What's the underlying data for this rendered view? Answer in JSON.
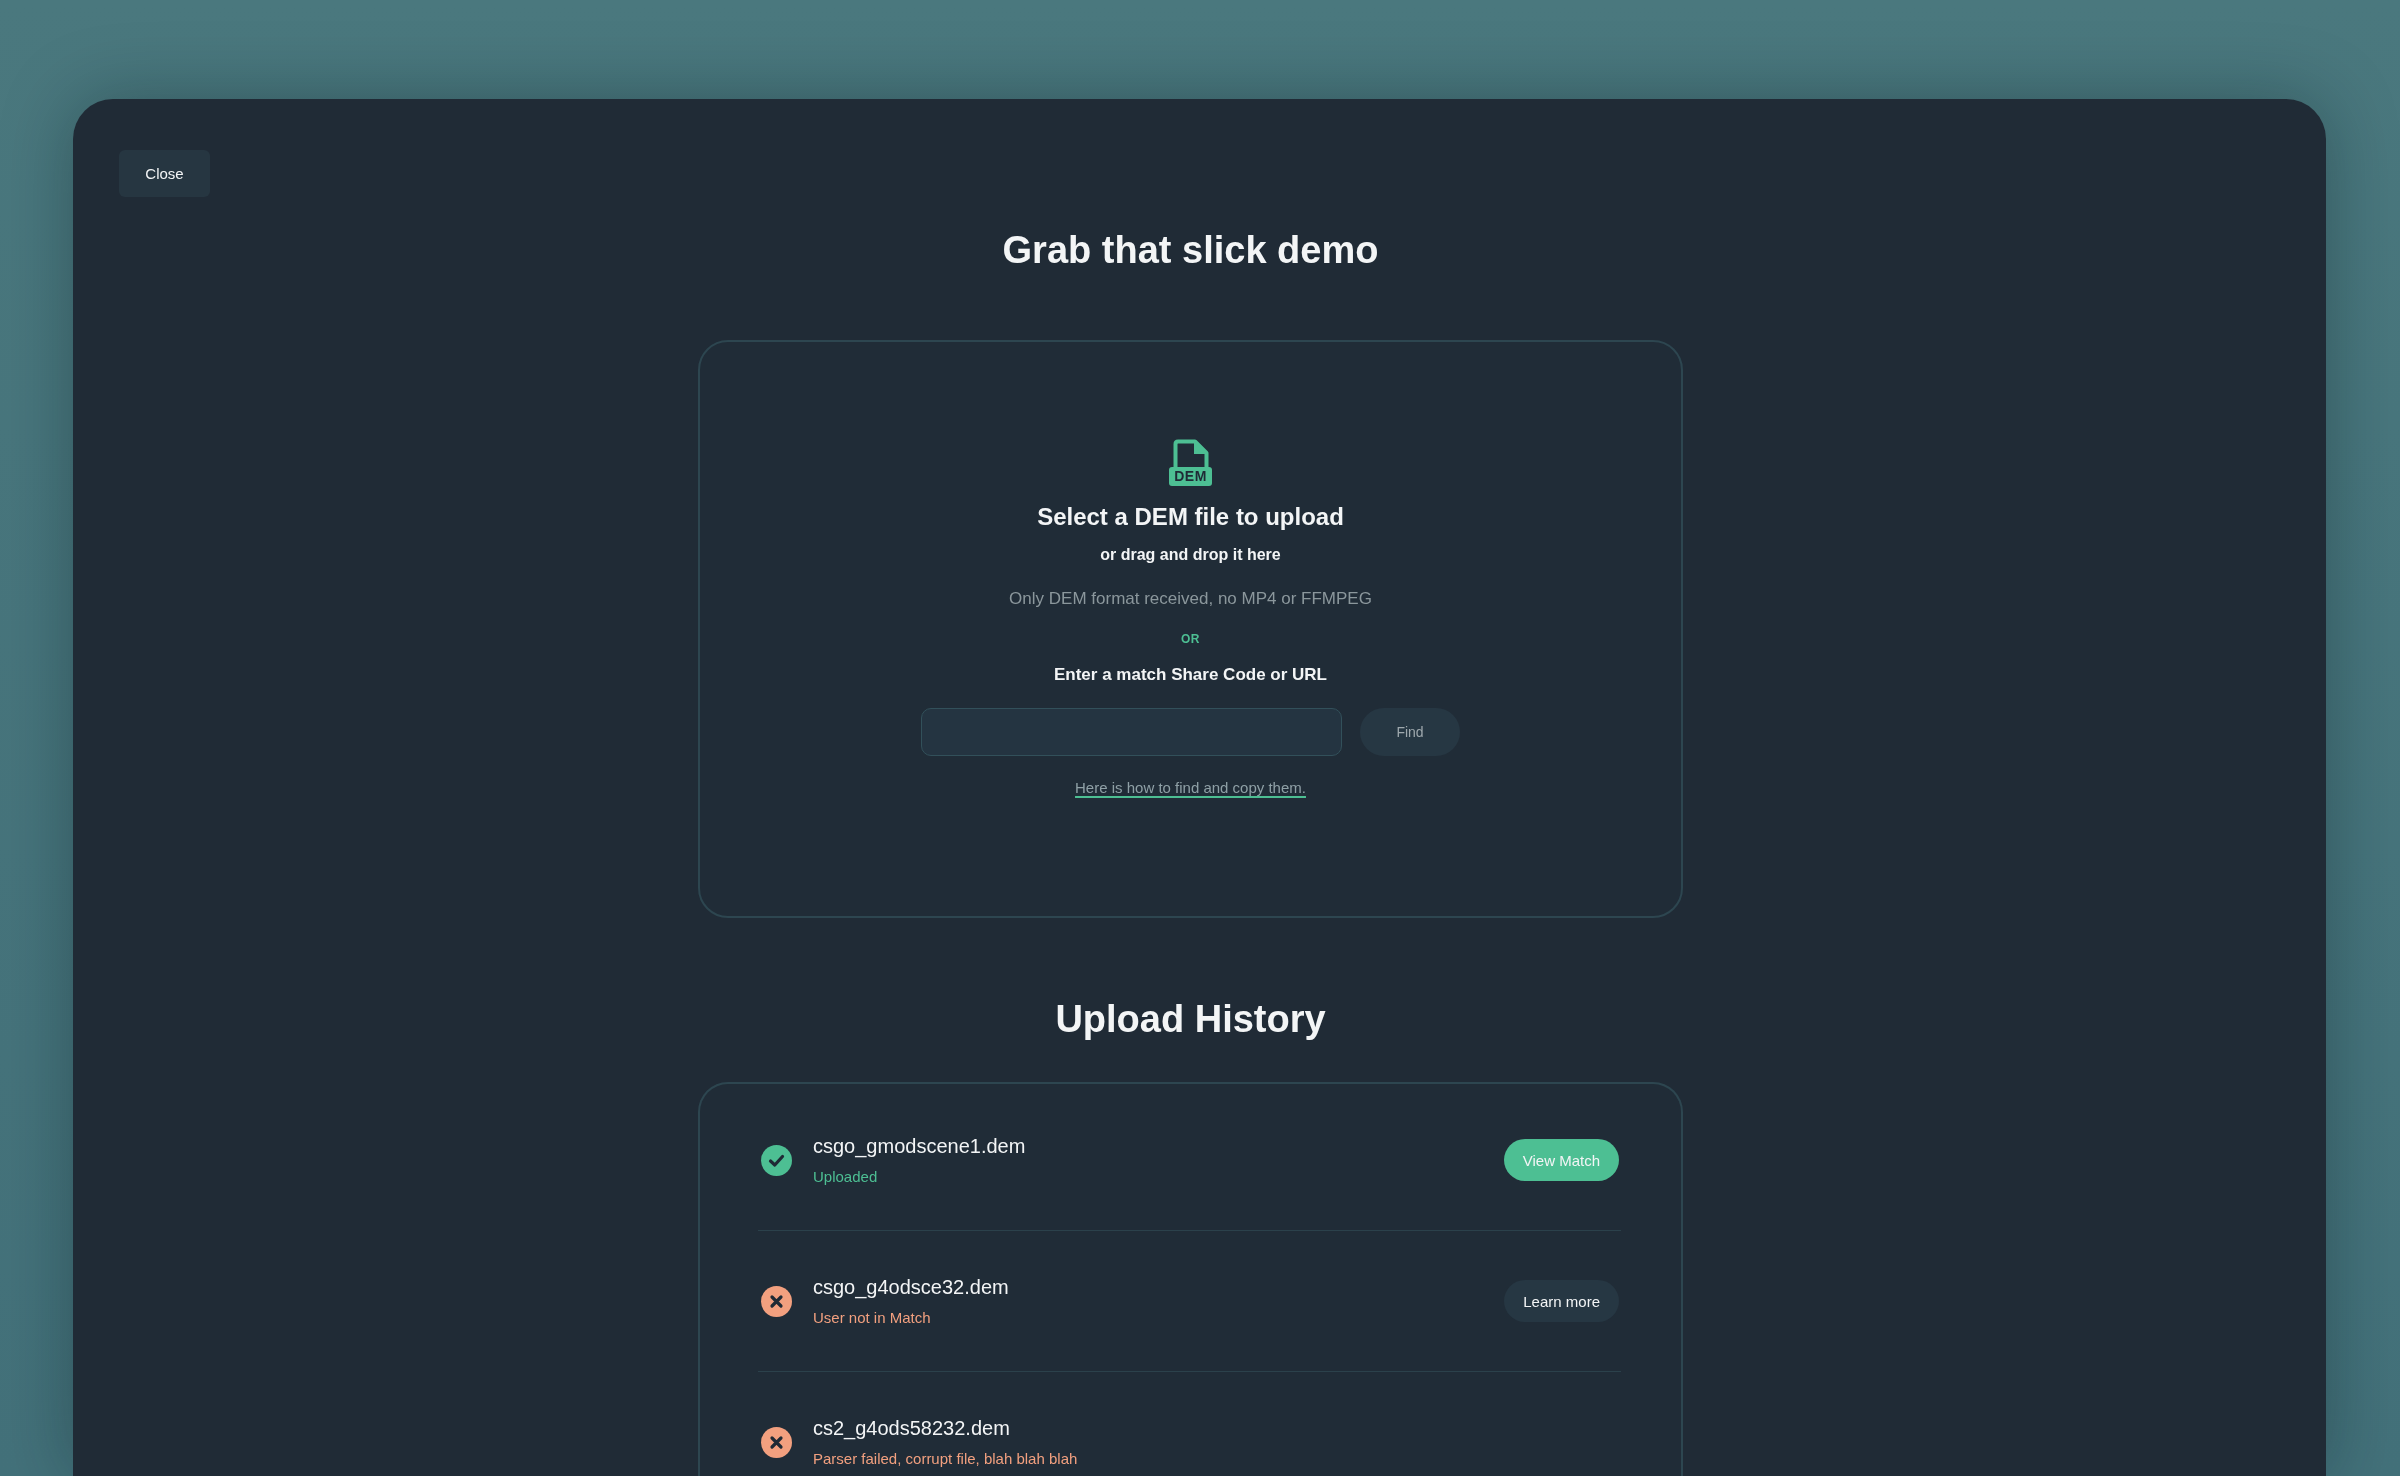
{
  "close_button": "Close",
  "title": "Grab that slick demo",
  "upload": {
    "file_type": "DEM",
    "heading": "Select a DEM file to upload",
    "subheading": "or drag and drop it here",
    "note": "Only DEM format received, no MP4 or FFMPEG",
    "separator": "OR",
    "share_code_label": "Enter a match Share Code or URL",
    "find_button": {
      "label": "Find",
      "disabled": true
    },
    "help_link": "Here is how to find and copy them."
  },
  "history": {
    "title": "Upload History",
    "items": [
      {
        "file": "csgo_gmodscene1.dem",
        "status": "Uploaded",
        "kind": "success",
        "action": "View Match"
      },
      {
        "file": "csgo_g4odsce32.dem",
        "status": "User not in Match",
        "kind": "error",
        "action": "Learn more"
      },
      {
        "file": "cs2_g4ods58232.dem",
        "status": "Parser failed, corrupt file, blah blah blah",
        "kind": "error"
      }
    ]
  }
}
